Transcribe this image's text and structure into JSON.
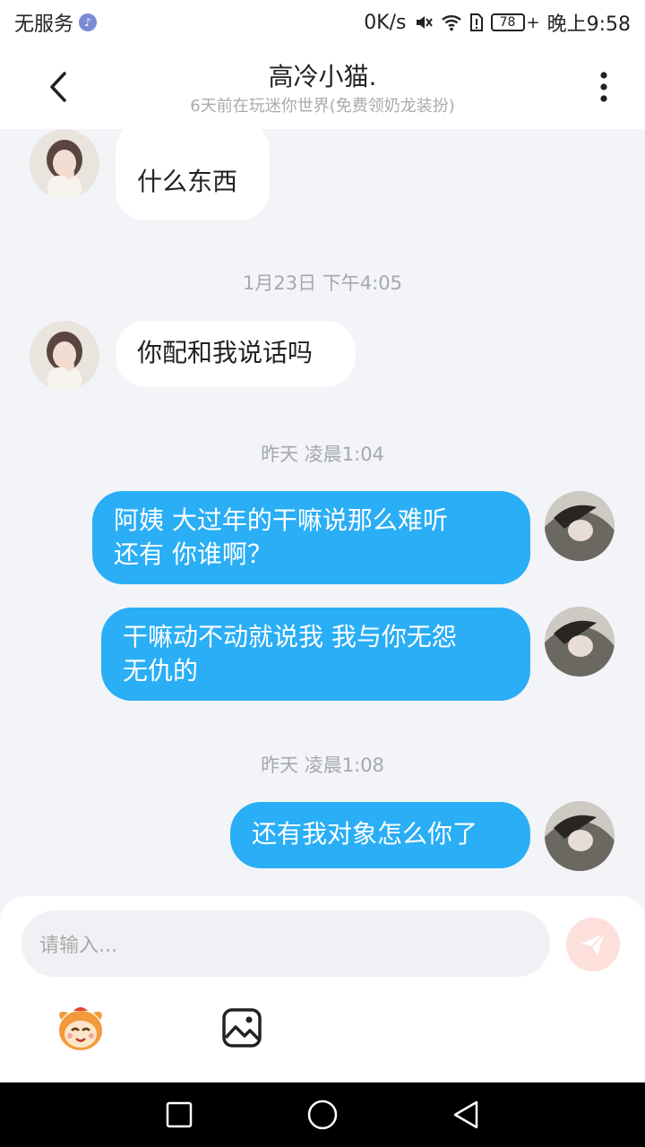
{
  "status_bar": {
    "carrier": "无服务",
    "speed": "0K/s",
    "battery": "78",
    "time": "晚上9:58"
  },
  "header": {
    "title": "高冷小猫.",
    "subtitle": "6天前在玩迷你世界(免费领奶龙装扮)"
  },
  "messages": [
    {
      "side": "in",
      "text": "什么东西"
    },
    {
      "side": "in",
      "text": "你配和我说话吗"
    },
    {
      "side": "out",
      "line1": "阿姨  大过年的干嘛说那么难听",
      "line2": "还有  你谁啊？"
    },
    {
      "side": "out",
      "line1": "干嘛动不动就说我  我与你无怨",
      "line2": "无仇的"
    },
    {
      "side": "out",
      "text": "还有我对象怎么你了"
    }
  ],
  "timestamps": [
    "1月23日 下午4:05",
    "昨天 凌晨1:04",
    "昨天 凌晨1:08"
  ],
  "input": {
    "placeholder": "请输入..."
  },
  "colors": {
    "outgoing_bubble": "#2aaef5",
    "incoming_bubble": "#ffffff",
    "background": "#f2f4f7",
    "send_button": "#fde0dc"
  },
  "icons": [
    "music-icon",
    "mute-icon",
    "wifi-icon",
    "sim-alert-icon",
    "battery-icon",
    "back-icon",
    "more-icon",
    "send-icon",
    "emoji-mascot-icon",
    "image-icon",
    "recent-apps-icon",
    "home-icon",
    "back-nav-icon"
  ]
}
